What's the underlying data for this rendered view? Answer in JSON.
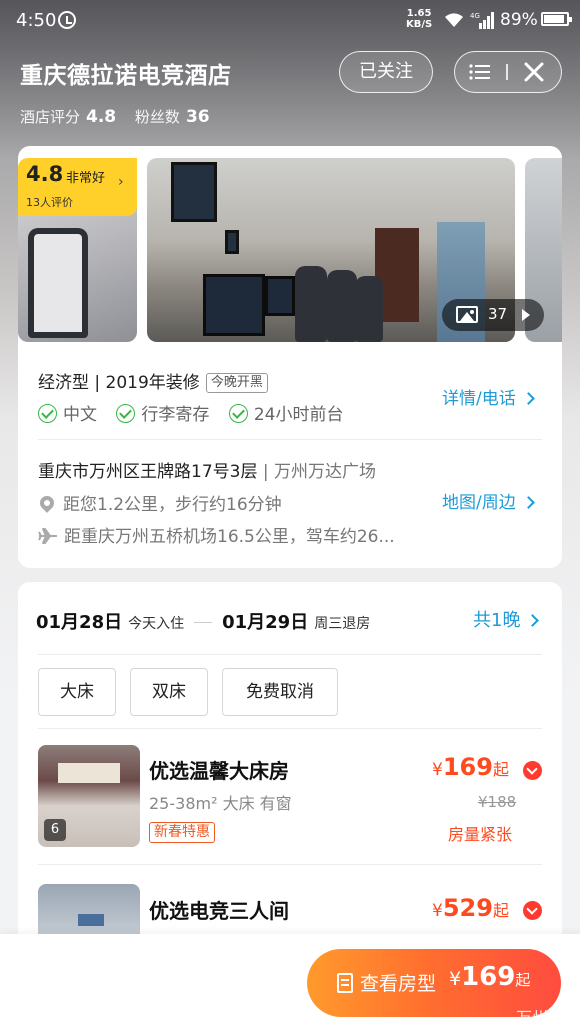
{
  "status_bar": {
    "time": "4:50",
    "net_speed_value": "1.65",
    "net_speed_unit": "KB/S",
    "network_type": "4G",
    "battery": "89%"
  },
  "header": {
    "hotel_name": "重庆德拉诺电竞酒店",
    "follow_label": "已关注",
    "score_label": "酒店评分",
    "score_value": "4.8",
    "fans_label": "粉丝数",
    "fans_value": "36"
  },
  "gallery": {
    "rating_score": "4.8",
    "rating_word": "非常好",
    "rating_count": "13人评价",
    "photo_count": "37"
  },
  "info": {
    "type_text": "经济型 | 2019年装修",
    "type_tag": "今晚开黑",
    "amenities": [
      "中文",
      "行李寄存",
      "24小时前台"
    ],
    "details_link": "详情/电话",
    "address_main": "重庆市万州区王牌路17号3层",
    "address_sub": " | 万州万达广场",
    "distance_user": "距您1.2公里，步行约16分钟",
    "distance_airport": "距重庆万州五桥机场16.5公里，驾车约26...",
    "map_link": "地图/周边"
  },
  "booking": {
    "checkin_date": "01月28日",
    "checkin_label": "今天入住",
    "checkout_date": "01月29日",
    "checkout_label": "周三退房",
    "nights_link": "共1晚",
    "filters": [
      "大床",
      "双床",
      "免费取消"
    ]
  },
  "rooms": [
    {
      "name": "优选温馨大床房",
      "spec": "25-38m² 大床 有窗",
      "promo": "新春特惠",
      "currency": "¥",
      "price": "169",
      "price_suffix": "起",
      "original_price": "¥188",
      "status": "房量紧张",
      "photo_count": "6"
    },
    {
      "name": "优选电竞三人间",
      "currency": "¥",
      "price": "529",
      "price_suffix": "起"
    }
  ],
  "bottom_bar": {
    "button_label": "查看房型",
    "currency": "¥",
    "price": "169",
    "price_suffix": "起"
  },
  "watermark": "万州"
}
